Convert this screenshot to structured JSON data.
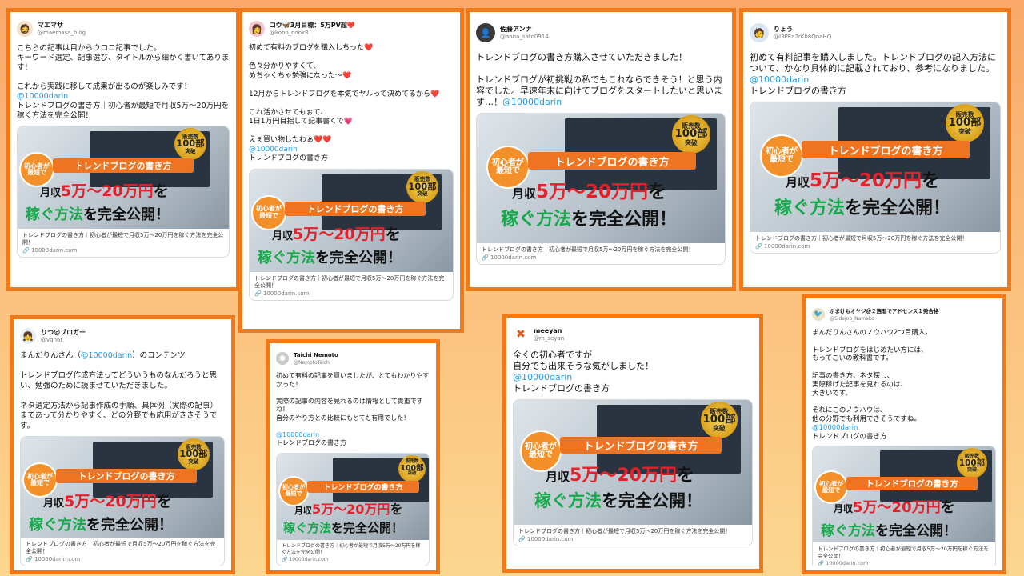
{
  "colors": {
    "frame": "#f07a1a",
    "mention": "#1d9bf0",
    "price_red": "#e4202a",
    "price_green": "#14a94a"
  },
  "promo": {
    "badge": [
      "販売数",
      "100部",
      "突破"
    ],
    "circle": [
      "初心者が",
      "最短で"
    ],
    "banner": "トレンドブログの書き方",
    "line1_prefix": "月収",
    "line1_price": "5万〜20万円",
    "line1_suffix": "を",
    "line2_green": "稼ぐ方法",
    "line2_rest": "を完全公開！"
  },
  "link_title": "トレンドブログの書き方｜初心者が最短で月収5万〜20万円を稼ぐ方法を完全公開！",
  "link_domain": "🔗 10000darin.com",
  "tweets": [
    {
      "name": "マエマサ",
      "handle": "@maemasa_blog",
      "avatar_icon": "man-illustration-icon",
      "text": "こちらの記事は目からウロコ記事でした。\nキーワード選定、記事選び、タイトルから細かく書いてあります！\n\nこれから実践に移して成果が出るのが楽しみです！",
      "mention": "@10000darin",
      "after": "\nトレンドブログの書き方｜初心者が最短で月収5万〜20万円を稼ぐ方法を完全公開！"
    },
    {
      "name": "コウ🦋3月目標：5万PV超❤️",
      "handle": "@kooo_oook8",
      "avatar_icon": "woman-avatar-icon",
      "text": "初めて有料のブログを購入しちった❤️\n\n色々分かりやすくて、\nめちゃくちゃ勉強になった〜❤️\n\n12月からトレンドブログを本気でヤルって決めてるから❤️\n\nこれ活かさせてもぉて、\n1日1万円目指して記事書くで💗\n\nえぇ買い物したわぁ❤️❤️\n",
      "mention": "@10000darin",
      "after": "\nトレンドブログの書き方"
    },
    {
      "name": "佐藤アンナ",
      "handle": "@anna_sato0914",
      "avatar_icon": "photo-avatar-icon",
      "text": "トレンドブログの書き方購入させていただきました！\n\nトレンドブログが初挑戦の私でもこれならできそう！と思う内容でした。早速年末に向けてブログをスタートしたいと思います…！",
      "mention": "@10000darin",
      "after": ""
    },
    {
      "name": "りょう",
      "handle": "@I3PEa2rKh8QnaHQ",
      "avatar_icon": "man-avatar-icon",
      "text": "初めて有料記事を購入しました。トレンドブログの記入方法について、かなり具体的に記載されており、参考になりました。\n",
      "mention": "@10000darin",
      "after": "\nトレンドブログの書き方"
    },
    {
      "name": "りつ@ブロガー",
      "handle": "@vqn6t",
      "avatar_icon": "girl-avatar-icon",
      "text": "まんだりんさん（",
      "mention": "@10000darin",
      "after": "）のコンテンツ\n\nトレンドブログ作成方法ってどういうものなんだろうと思い、勉強のために読ませていただきました。\n\nネタ選定方法から記事作成の手順、具体例（実際の記事）まであって分かりやすく、どの分野でも応用がききそうです。"
    },
    {
      "name": "Taichi Nemoto",
      "handle": "@NemotoTaichi",
      "avatar_icon": "default-avatar-icon",
      "text": "初めて有料の記事を買いましたが、とてもわかりやすかった！\n\n実際の記事の内容を見れるのは情報として貴重ですね！\n自分のやり方との比較にもとても有用でした！\n\n",
      "mention": "@10000darin",
      "after": "\nトレンドブログの書き方"
    },
    {
      "name": "meeyan",
      "handle": "@m_seyan",
      "avatar_icon": "cross-avatar-icon",
      "text": "全くの初心者ですが\n自分でも出来そうな気がしました！\n",
      "mention": "@10000darin",
      "after": "\nトレンドブログの書き方"
    },
    {
      "name": "ぶまけもオヤジ＠２週間でアドセンス１発合格",
      "handle": "@Sidejob_Namako",
      "avatar_icon": "bird-avatar-icon",
      "text": "まんだりんさんのノウハウ2つ目購入。\n\nトレンドブログをはじめたい方には、\nもってこいの教科書です。\n\n記事の書き方、ネタ探し、\n実際稼げた記事を見れるのは、\n大きいです。\n\nそれにこのノウハウは、\n他の分野でも利用できそうですね。\n",
      "mention": "@10000darin",
      "after": "\nトレンドブログの書き方"
    }
  ]
}
